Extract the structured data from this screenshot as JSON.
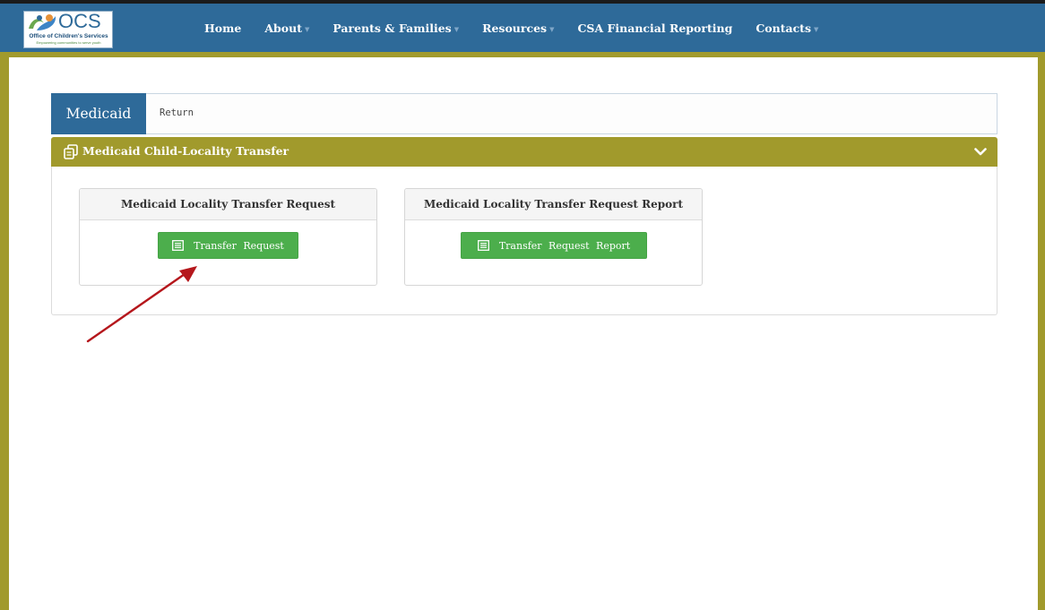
{
  "logo": {
    "name": "OCS",
    "subtitle": "Office of Children's Services",
    "tagline": "Empowering communities to serve youth"
  },
  "nav": {
    "items": [
      {
        "label": "Home",
        "has_dropdown": false
      },
      {
        "label": "About",
        "has_dropdown": true
      },
      {
        "label": "Parents & Families",
        "has_dropdown": true
      },
      {
        "label": "Resources",
        "has_dropdown": true
      },
      {
        "label": "CSA Financial Reporting",
        "has_dropdown": false
      },
      {
        "label": "Contacts",
        "has_dropdown": true
      }
    ]
  },
  "page": {
    "title": "Medicaid",
    "return_label": "Return"
  },
  "panel": {
    "title": "Medicaid Child-Locality Transfer",
    "icon": "copy-icon",
    "collapse_icon": "chevron-down-icon"
  },
  "cards": [
    {
      "title": "Medicaid Locality Transfer Request",
      "button_label": "Transfer Request",
      "button_icon": "list-icon"
    },
    {
      "title": "Medicaid Locality Transfer Request Report",
      "button_label": "Transfer Request Report",
      "button_icon": "list-icon"
    }
  ],
  "colors": {
    "navbar": "#2e6a99",
    "frame": "#a19a2c",
    "button_green": "#4cae4c",
    "annotation_arrow": "#b5171c"
  }
}
